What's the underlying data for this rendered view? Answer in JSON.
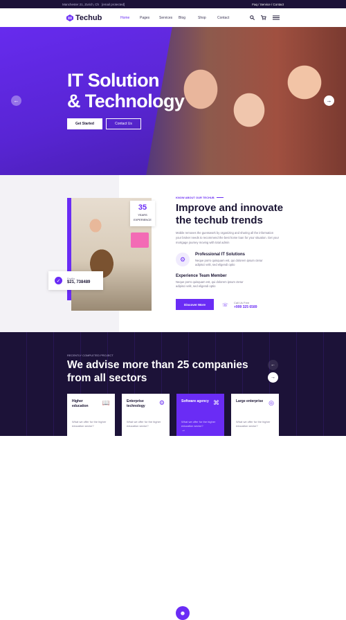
{
  "topbar": {
    "address": "Manchester 21, Zurich, Ch",
    "email": "[email protected]",
    "right_links": "Faq / Service / Contact"
  },
  "header": {
    "logo": "Techub",
    "nav": [
      "Home",
      "Pages",
      "Services",
      "Blog",
      "Shop",
      "Contact"
    ],
    "active_nav": "Home"
  },
  "hero": {
    "title_line1": "IT Solution",
    "title_line2": "& Technology",
    "primary_button": "Get Started",
    "secondary_button": "Contact Us"
  },
  "about": {
    "badge_number": "35",
    "badge_label_1": "YEARS",
    "badge_label_2": "EXPERIENCE",
    "profit_label": "Profits",
    "profit_value": "$21, 738489",
    "eyebrow": "KNOW ABOUT OUR TECHUB",
    "title": "Improve and innovate the techub trends",
    "description": "Mobile removes the guesswork by organizing and sharing all the information your broker needs to recommend the best home loan for your situation. Get your mortgage journey moving with total admin",
    "features": [
      {
        "title": "Professional IT Solutions",
        "desc": "Neque porro quisquam est, qui dolorem ipsum ctetur adipisci velit, sed eligendi optio"
      },
      {
        "title": "Experience Team Member",
        "desc": "Neque porro quisquam est, qui dolorem ipsum ctetur adipisci velit, sed eligendi optio"
      }
    ],
    "button": "Discover More",
    "call_label": "Call Us Free",
    "call_number": "+999 325 6589"
  },
  "projects": {
    "eyebrow": "RECENTLY COMPLETED PROJECT",
    "title": "We advise more than 25 companies from all sectors",
    "cards": [
      {
        "title": "Higher education",
        "desc": "What we offer for the higher education sector?"
      },
      {
        "title": "Enterprise technology",
        "desc": "What we offer for the higher education sector?"
      },
      {
        "title": "Software agency",
        "desc": "What we offer for the higher education sector?"
      },
      {
        "title": "Large enterprise",
        "desc": "What we offer for the higher education sector?"
      }
    ]
  },
  "colors": {
    "accent": "#6a2cf5",
    "dark": "#1c1238"
  }
}
